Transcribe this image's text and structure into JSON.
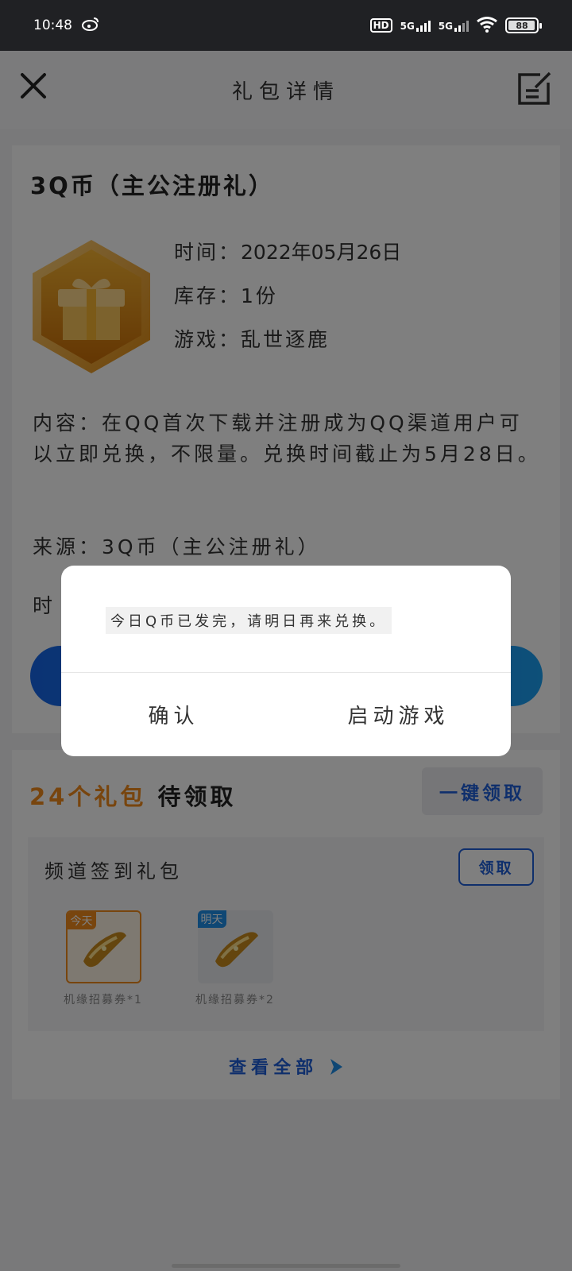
{
  "status_bar": {
    "time": "10:48",
    "hd": "HD",
    "sim1": "5G",
    "sim2": "5G",
    "battery": "88"
  },
  "header": {
    "title": "礼包详情"
  },
  "gift": {
    "name": "3Q币（主公注册礼）",
    "time_label": "时间：",
    "time_value": "2022年05月26日",
    "stock_label": "库存：",
    "stock_value": "1份",
    "game_label": "游戏：",
    "game_value": "乱世逐鹿",
    "content": "内容：在QQ首次下载并注册成为QQ渠道用户可以立即兑换，不限量。兑换时间截止为5月28日。",
    "source": "来源：3Q币（主公注册礼）",
    "time_partial": "时"
  },
  "gifts_section": {
    "count": "24个礼包",
    "pending": "待领取",
    "one_click": "一键领取",
    "daily_title": "频道签到礼包",
    "claim": "领取",
    "items": [
      {
        "tag": "今天",
        "label": "机缘招募券*1"
      },
      {
        "tag": "明天",
        "label": "机缘招募券*2"
      }
    ],
    "view_all": "查看全部"
  },
  "dialog": {
    "message": "今日Q币已发完，请明日再来兑换。",
    "confirm": "确认",
    "launch": "启动游戏"
  },
  "colors": {
    "accent_blue": "#1f5fd8",
    "accent_orange": "#f08a1c"
  }
}
